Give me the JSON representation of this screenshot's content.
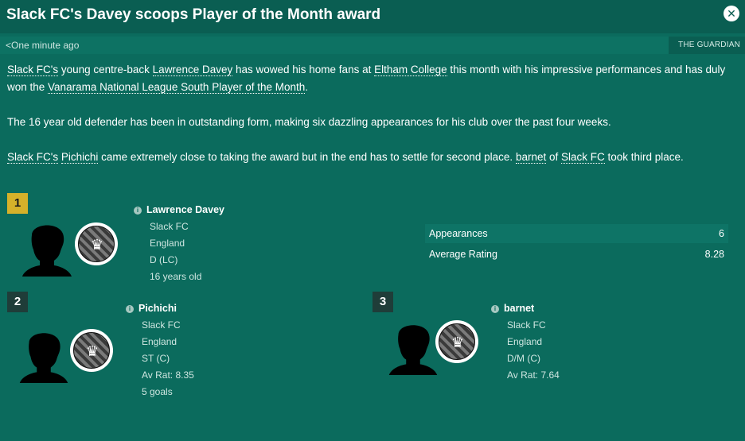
{
  "header": {
    "title": "Slack FC's Davey scoops Player of the Month award"
  },
  "subheader": {
    "timestamp": "<One minute ago",
    "source": "THE GUARDIAN"
  },
  "article": {
    "p1": {
      "t1": "Slack FC's",
      "t2": " young centre-back ",
      "t3": "Lawrence Davey",
      "t4": " has wowed his home fans at ",
      "t5": "Eltham College",
      "t6": " this month with his impressive performances and has duly won the ",
      "t7": "Vanarama National League South Player of the Month",
      "t8": "."
    },
    "p2": "The 16 year old defender has been in outstanding form, making six dazzling appearances for his club over the past four weeks.",
    "p3": {
      "t1": "Slack FC's",
      "t2": " ",
      "t3": "Pichichi",
      "t4": " came extremely close to taking the award but in the end has to settle for second place. ",
      "t5": "barnet",
      "t6": " of ",
      "t7": "Slack FC",
      "t8": " took third place."
    }
  },
  "winner": {
    "rank": "1",
    "name": "Lawrence Davey",
    "club": "Slack FC",
    "nation": "England",
    "position": "D (LC)",
    "age": "16 years old",
    "crest_icon": "crown-icon",
    "stats": [
      {
        "label": "Appearances",
        "value": "6"
      },
      {
        "label": "Average Rating",
        "value": "8.28"
      }
    ]
  },
  "second": {
    "rank": "2",
    "name": "Pichichi",
    "club": "Slack FC",
    "nation": "England",
    "position": "ST (C)",
    "rating": "Av Rat: 8.35",
    "goals": "5 goals",
    "crest_icon": "crown-icon"
  },
  "third": {
    "rank": "3",
    "name": "barnet",
    "club": "Slack FC",
    "nation": "England",
    "position": "D/M (C)",
    "rating": "Av Rat: 7.64",
    "crest_icon": "crown-icon"
  },
  "colors": {
    "background": "#0b6b5d",
    "header": "#0a5e52",
    "rank_gold": "#d6b12a",
    "rank_dark": "#1f3d39"
  }
}
